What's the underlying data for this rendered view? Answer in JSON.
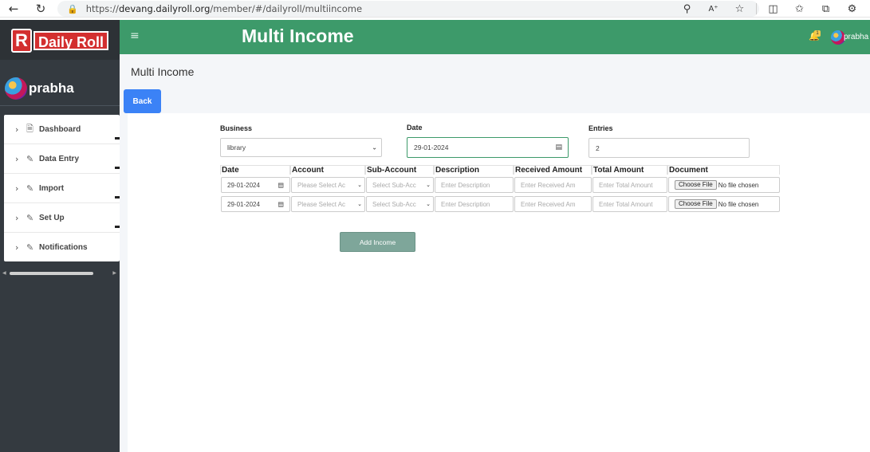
{
  "browser": {
    "url_prefix": "https://",
    "url_host": "devang.dailyroll.org",
    "url_path": "/member/#/dailyroll/multiincome"
  },
  "sidebar": {
    "logo_letter": "R",
    "logo_text": "Daily Roll",
    "user_name": "prabha",
    "items": [
      {
        "label": "Dashboard",
        "icon": "file-icon"
      },
      {
        "label": "Data Entry",
        "icon": "pencil-icon"
      },
      {
        "label": "Import",
        "icon": "pencil-icon"
      },
      {
        "label": "Set Up",
        "icon": "pencil-icon"
      },
      {
        "label": "Notifications",
        "icon": "pencil-icon"
      }
    ]
  },
  "topbar": {
    "title": "Multi Income",
    "notification_count": "1",
    "user_name": "prabha"
  },
  "page": {
    "title": "Multi Income",
    "back_label": "Back"
  },
  "form": {
    "business_label": "Business",
    "business_value": "library",
    "date_label": "Date",
    "date_value": "29-01-2024",
    "entries_label": "Entries",
    "entries_value": "2"
  },
  "table": {
    "headers": [
      "Date",
      "Account",
      "Sub-Account",
      "Description",
      "Received Amount",
      "Total Amount",
      "Document"
    ],
    "rows": [
      {
        "date": "29-01-2024",
        "account_placeholder": "Please Select Ac",
        "subaccount_placeholder": "Select Sub-Acc",
        "description_placeholder": "Enter Description",
        "received_placeholder": "Enter Received Am",
        "total_placeholder": "Enter Total Amount",
        "file_button": "Choose File",
        "file_status": "No file chosen"
      },
      {
        "date": "29-01-2024",
        "account_placeholder": "Please Select Ac",
        "subaccount_placeholder": "Select Sub-Acc",
        "description_placeholder": "Enter Description",
        "received_placeholder": "Enter Received Am",
        "total_placeholder": "Enter Total Amount",
        "file_button": "Choose File",
        "file_status": "No file chosen"
      }
    ]
  },
  "actions": {
    "add_label": "Add Income"
  },
  "colors": {
    "topbar": "#3d9a6a",
    "sidebar": "#343a40",
    "back_button": "#3b82f6",
    "add_button": "#7ea69a"
  }
}
